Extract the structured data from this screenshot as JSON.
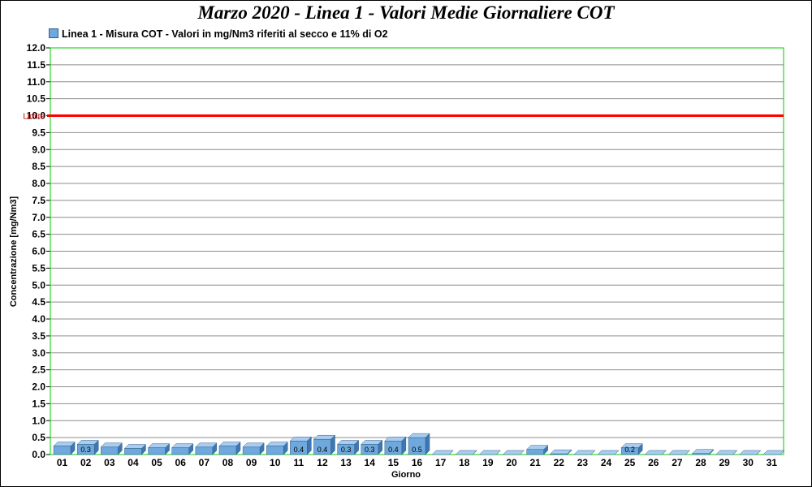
{
  "chart_data": {
    "type": "bar",
    "title": "Marzo 2020 - Linea 1 - Valori Medie Giornaliere COT",
    "xlabel": "Giorno",
    "ylabel": "Concentrazione [mg/Nm3]",
    "ylim": [
      0,
      12
    ],
    "ytick_step": 0.5,
    "grid": true,
    "legend_position": "top-left",
    "categories": [
      "01",
      "02",
      "03",
      "04",
      "05",
      "06",
      "07",
      "08",
      "09",
      "10",
      "11",
      "12",
      "13",
      "14",
      "15",
      "16",
      "17",
      "18",
      "19",
      "20",
      "21",
      "22",
      "23",
      "24",
      "25",
      "26",
      "27",
      "28",
      "29",
      "30",
      "31"
    ],
    "series": [
      {
        "name": "Linea 1 - Misura COT - Valori in mg/Nm3 riferiti al secco e 11% di O2",
        "values": [
          0.25,
          0.3,
          0.22,
          0.18,
          0.2,
          0.2,
          0.22,
          0.25,
          0.22,
          0.25,
          0.4,
          0.45,
          0.3,
          0.3,
          0.4,
          0.5,
          0.0,
          0.0,
          0.0,
          0.0,
          0.15,
          0.02,
          0.0,
          0.0,
          0.2,
          0.0,
          0.0,
          0.03,
          0.0,
          0.0,
          0.0
        ],
        "labels": [
          "",
          "0.3",
          "",
          "",
          "",
          "",
          "",
          "",
          "",
          "",
          "0.4",
          "0.4",
          "0.3",
          "0.3",
          "0.4",
          "0.5",
          "",
          "",
          "",
          "",
          "",
          "",
          "",
          "",
          "0.2",
          "",
          "",
          "",
          "",
          "",
          ""
        ],
        "color": "#6fa8dc"
      }
    ],
    "limit": {
      "label": "Limite",
      "value": 10,
      "color": "#ff0000"
    }
  },
  "colors": {
    "bar_face": "#6fa8dc",
    "bar_top": "#a9cdf0",
    "bar_side": "#3d78b3",
    "grid": "#8c8c8c",
    "plot_border": "#00cc00"
  }
}
